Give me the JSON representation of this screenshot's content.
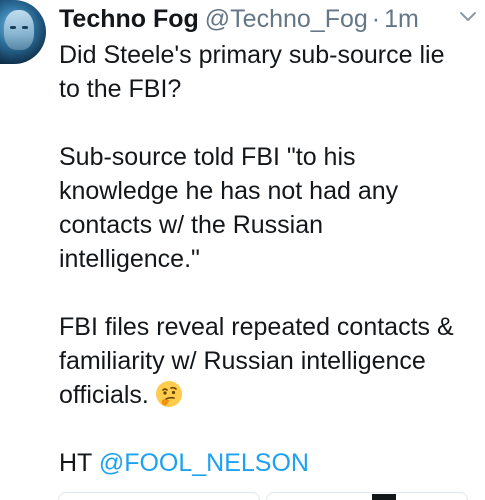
{
  "author": {
    "display_name": "Techno Fog",
    "handle": "@Techno_Fog",
    "separator": "·",
    "timestamp": "1m"
  },
  "tweet": {
    "para1": "Did Steele's primary sub-source lie\nto the FBI?",
    "para2": "Sub-source told FBI \"to his\nknowledge he has not had any\ncontacts w/ the Russian\nintelligence.\"",
    "para3": "FBI files reveal repeated contacts &\nfamiliarity w/ Russian intelligence\nofficials.",
    "para3_emoji": "thinking-face-icon",
    "ht_prefix": "HT ",
    "mention": "@FOOL_NELSON"
  },
  "icons": {
    "menu": "chevron-down-icon",
    "avatar": "avatar"
  },
  "colors": {
    "text": "#14171a",
    "muted": "#657786",
    "link": "#1da1f2",
    "emoji": "#ffcc4d"
  }
}
